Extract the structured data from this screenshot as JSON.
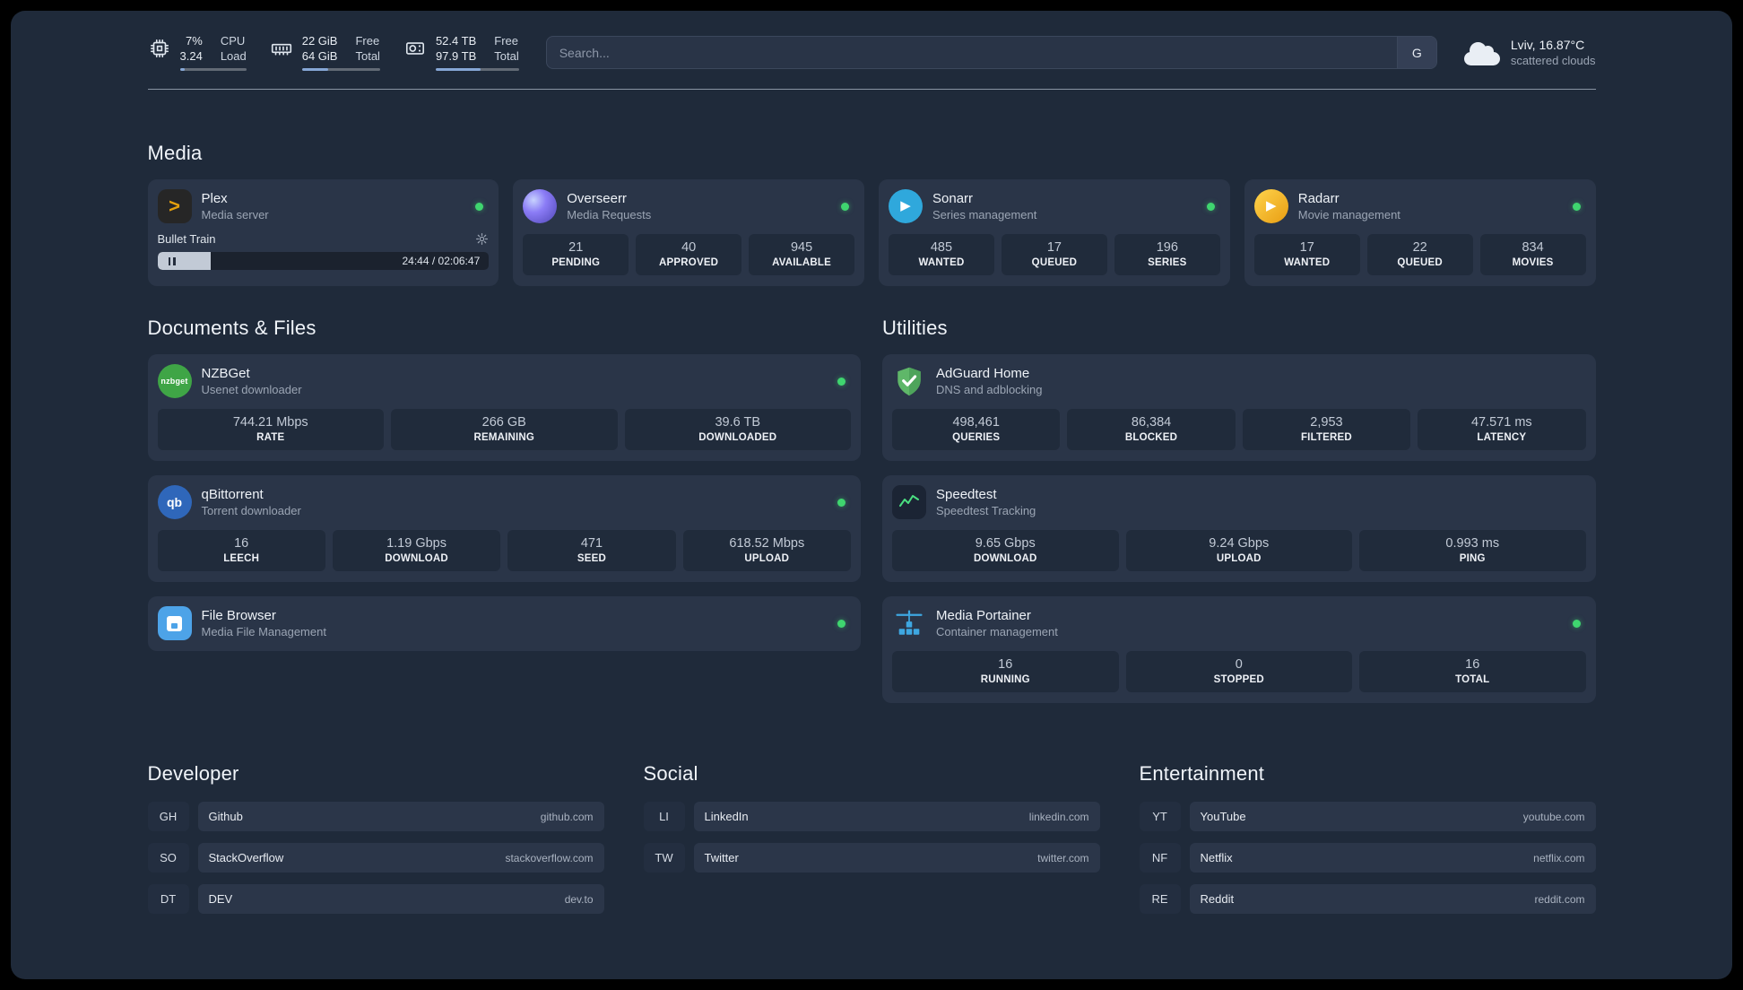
{
  "colors": {
    "page_bg": "#1f2a3a",
    "card_bg": "#2a3548",
    "stat_bg": "#202b3b",
    "accent_green": "#3fd56f",
    "text_primary": "#e9edf2",
    "text_secondary": "#9ba5b4"
  },
  "topbar": {
    "resources": [
      {
        "icon": "cpu-icon",
        "value_top": "7%",
        "label_top": "CPU",
        "value_bottom": "3.24",
        "label_bottom": "Load",
        "bar_percent": 7
      },
      {
        "icon": "memory-icon",
        "value_top": "22 GiB",
        "label_top": "Free",
        "value_bottom": "64 GiB",
        "label_bottom": "Total",
        "bar_percent": 34
      },
      {
        "icon": "disk-icon",
        "value_top": "52.4 TB",
        "label_top": "Free",
        "value_bottom": "97.9 TB",
        "label_bottom": "Total",
        "bar_percent": 54
      }
    ],
    "search": {
      "placeholder": "Search...",
      "provider_label": "G"
    },
    "weather": {
      "icon": "cloud-icon",
      "location": "Lviv, 16.87°C",
      "condition": "scattered clouds"
    }
  },
  "media": {
    "heading": "Media",
    "plex": {
      "icon": "plex-icon",
      "title": "Plex",
      "subtitle": "Media server",
      "online": true,
      "now_playing": {
        "track": "Bullet Train",
        "time": "24:44 / 02:06:47",
        "progress_percent": 16
      }
    },
    "overseerr": {
      "icon": "overseerr-icon",
      "title": "Overseerr",
      "subtitle": "Media Requests",
      "online": true,
      "stats": [
        {
          "value": "21",
          "label": "PENDING"
        },
        {
          "value": "40",
          "label": "APPROVED"
        },
        {
          "value": "945",
          "label": "AVAILABLE"
        }
      ]
    },
    "sonarr": {
      "icon": "sonarr-icon",
      "title": "Sonarr",
      "subtitle": "Series management",
      "online": true,
      "stats": [
        {
          "value": "485",
          "label": "WANTED"
        },
        {
          "value": "17",
          "label": "QUEUED"
        },
        {
          "value": "196",
          "label": "SERIES"
        }
      ]
    },
    "radarr": {
      "icon": "radarr-icon",
      "title": "Radarr",
      "subtitle": "Movie management",
      "online": true,
      "stats": [
        {
          "value": "17",
          "label": "WANTED"
        },
        {
          "value": "22",
          "label": "QUEUED"
        },
        {
          "value": "834",
          "label": "MOVIES"
        }
      ]
    }
  },
  "documents": {
    "heading": "Documents & Files",
    "nzbget": {
      "icon": "nzbget-icon",
      "icon_text": "nzbget",
      "title": "NZBGet",
      "subtitle": "Usenet downloader",
      "online": true,
      "stats": [
        {
          "value": "744.21 Mbps",
          "label": "RATE"
        },
        {
          "value": "266 GB",
          "label": "REMAINING"
        },
        {
          "value": "39.6 TB",
          "label": "DOWNLOADED"
        }
      ]
    },
    "qbittorrent": {
      "icon": "qbittorrent-icon",
      "icon_text": "qb",
      "title": "qBittorrent",
      "subtitle": "Torrent downloader",
      "online": true,
      "stats": [
        {
          "value": "16",
          "label": "LEECH"
        },
        {
          "value": "1.19 Gbps",
          "label": "DOWNLOAD"
        },
        {
          "value": "471",
          "label": "SEED"
        },
        {
          "value": "618.52 Mbps",
          "label": "UPLOAD"
        }
      ]
    },
    "filebrowser": {
      "icon": "filebrowser-icon",
      "title": "File Browser",
      "subtitle": "Media File Management",
      "online": true
    }
  },
  "utilities": {
    "heading": "Utilities",
    "adguard": {
      "icon": "adguard-icon",
      "title": "AdGuard Home",
      "subtitle": "DNS and adblocking",
      "online": false,
      "stats": [
        {
          "value": "498,461",
          "label": "QUERIES"
        },
        {
          "value": "86,384",
          "label": "BLOCKED"
        },
        {
          "value": "2,953",
          "label": "FILTERED"
        },
        {
          "value": "47.571 ms",
          "label": "LATENCY"
        }
      ]
    },
    "speedtest": {
      "icon": "speedtest-icon",
      "title": "Speedtest",
      "subtitle": "Speedtest Tracking",
      "online": false,
      "stats": [
        {
          "value": "9.65 Gbps",
          "label": "DOWNLOAD"
        },
        {
          "value": "9.24 Gbps",
          "label": "UPLOAD"
        },
        {
          "value": "0.993 ms",
          "label": "PING"
        }
      ]
    },
    "portainer": {
      "icon": "portainer-icon",
      "title": "Media Portainer",
      "subtitle": "Container management",
      "online": true,
      "stats": [
        {
          "value": "16",
          "label": "RUNNING"
        },
        {
          "value": "0",
          "label": "STOPPED"
        },
        {
          "value": "16",
          "label": "TOTAL"
        }
      ]
    }
  },
  "bookmarks": [
    {
      "heading": "Developer",
      "items": [
        {
          "abbr": "GH",
          "name": "Github",
          "url": "github.com"
        },
        {
          "abbr": "SO",
          "name": "StackOverflow",
          "url": "stackoverflow.com"
        },
        {
          "abbr": "DT",
          "name": "DEV",
          "url": "dev.to"
        }
      ]
    },
    {
      "heading": "Social",
      "items": [
        {
          "abbr": "LI",
          "name": "LinkedIn",
          "url": "linkedin.com"
        },
        {
          "abbr": "TW",
          "name": "Twitter",
          "url": "twitter.com"
        }
      ]
    },
    {
      "heading": "Entertainment",
      "items": [
        {
          "abbr": "YT",
          "name": "YouTube",
          "url": "youtube.com"
        },
        {
          "abbr": "NF",
          "name": "Netflix",
          "url": "netflix.com"
        },
        {
          "abbr": "RE",
          "name": "Reddit",
          "url": "reddit.com"
        }
      ]
    }
  ]
}
